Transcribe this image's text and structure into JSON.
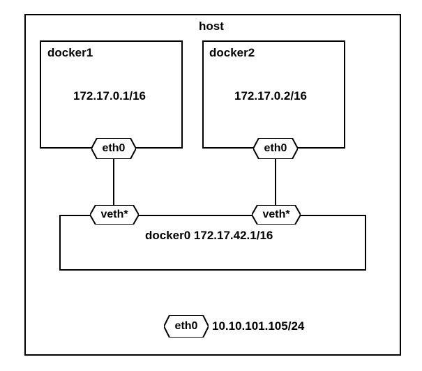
{
  "host": {
    "title": "host",
    "eth0_label": "eth0",
    "eth0_ip": "10.10.101.105/24"
  },
  "containers": [
    {
      "name": "docker1",
      "ip": "172.17.0.1/16",
      "iface": "eth0"
    },
    {
      "name": "docker2",
      "ip": "172.17.0.2/16",
      "iface": "eth0"
    }
  ],
  "bridge": {
    "label": "docker0 172.17.42.1/16",
    "veth_left": "veth*",
    "veth_right": "veth*"
  }
}
